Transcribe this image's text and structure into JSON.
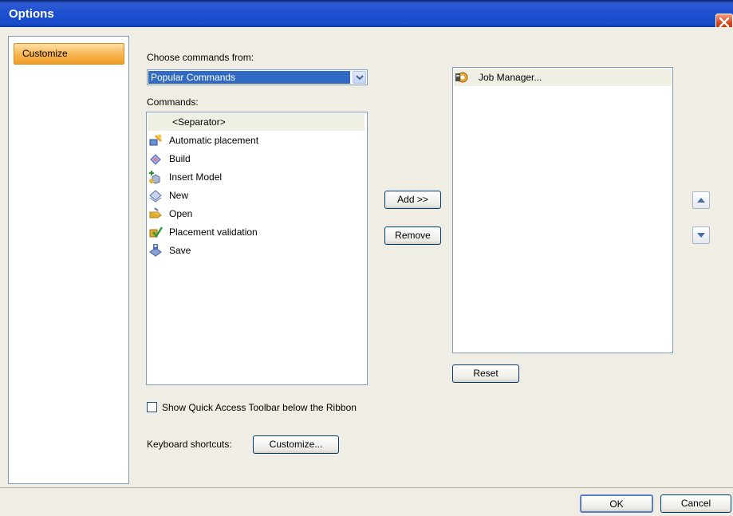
{
  "window": {
    "title": "Options"
  },
  "sidebar": {
    "items": [
      {
        "label": "Customize",
        "selected": true
      }
    ]
  },
  "choose": {
    "label": "Choose commands from:",
    "selected": "Popular Commands"
  },
  "commands": {
    "label": "Commands:",
    "items": [
      {
        "label": "<Separator>",
        "icon": "separator"
      },
      {
        "label": "Automatic placement",
        "icon": "automatic-placement-icon"
      },
      {
        "label": "Build",
        "icon": "build-icon"
      },
      {
        "label": "Insert Model",
        "icon": "insert-model-icon"
      },
      {
        "label": "New",
        "icon": "new-icon"
      },
      {
        "label": "Open",
        "icon": "open-icon"
      },
      {
        "label": "Placement validation",
        "icon": "placement-validation-icon"
      },
      {
        "label": "Save",
        "icon": "save-icon"
      }
    ]
  },
  "buttons": {
    "add": "Add >>",
    "remove": "Remove",
    "reset": "Reset",
    "customize": "Customize...",
    "ok": "OK",
    "cancel": "Cancel"
  },
  "toolbar": {
    "items": [
      {
        "label": "Job Manager...",
        "icon": "job-manager-icon"
      }
    ]
  },
  "checkbox": {
    "label": "Show Quick Access Toolbar below the Ribbon",
    "checked": false
  },
  "keyboard": {
    "label": "Keyboard shortcuts:"
  },
  "colors": {
    "titlebar": "#1d4fd0",
    "selection": "#316ac5",
    "sidebar_selected": "#f7b34d",
    "dialog_bg": "#f0eee4"
  }
}
